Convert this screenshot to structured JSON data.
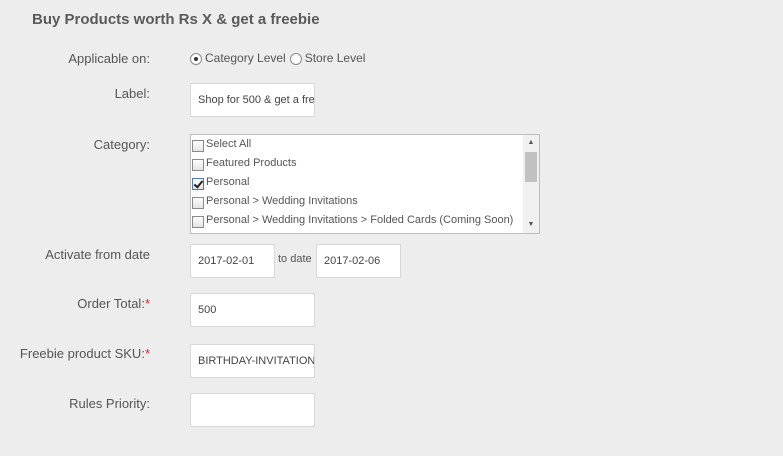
{
  "title": "Buy Products worth Rs X & get a freebie",
  "applicable": {
    "label": "Applicable on:",
    "options": [
      "Category Level",
      "Store Level"
    ],
    "selected": "Category Level"
  },
  "label_field": {
    "label": "Label:",
    "value": "Shop for 500 & get a fre"
  },
  "category": {
    "label": "Category:",
    "items": [
      {
        "text": "Select All",
        "checked": false
      },
      {
        "text": "Featured Products",
        "checked": false
      },
      {
        "text": "Personal",
        "checked": true
      },
      {
        "text": "Personal > Wedding Invitations",
        "checked": false
      },
      {
        "text": "Personal > Wedding Invitations > Folded Cards (Coming Soon)",
        "checked": false
      }
    ]
  },
  "dates": {
    "label": "Activate from date",
    "from": "2017-02-01",
    "to_label": "to date",
    "to": "2017-02-06"
  },
  "order_total": {
    "label": "Order Total:",
    "required_mark": "*",
    "value": "500"
  },
  "freebie_sku": {
    "label": "Freebie product SKU:",
    "required_mark": "*",
    "value": "BIRTHDAY-INVITATION"
  },
  "rules_priority": {
    "label": "Rules Priority:",
    "value": ""
  },
  "icons": {
    "scroll_up": "▲",
    "scroll_down": "▼"
  }
}
